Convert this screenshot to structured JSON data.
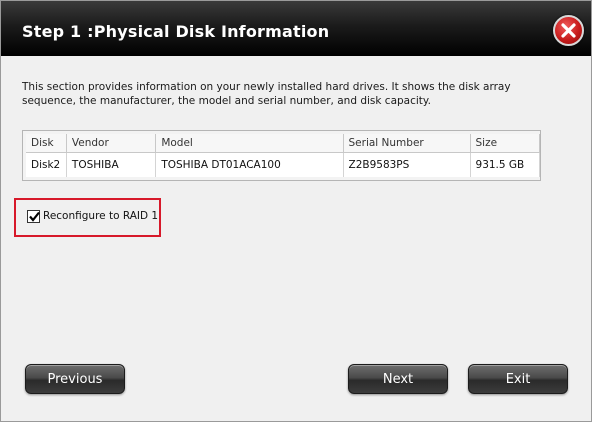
{
  "dialog": {
    "title": "Step 1 :Physical Disk Information",
    "close_icon": "close-icon",
    "description": "This section provides information on your newly installed hard drives. It shows the disk array sequence, the manufacturer, the model and serial number, and disk capacity."
  },
  "table": {
    "headers": [
      "Disk",
      "Vendor",
      "Model",
      "Serial Number",
      "Size"
    ],
    "rows": [
      [
        "Disk2",
        "TOSHIBA",
        "TOSHIBA DT01ACA100",
        "Z2B9583PS",
        "931.5 GB"
      ]
    ]
  },
  "reconfigure": {
    "checked": true,
    "label": "Reconfigure to RAID 1",
    "highlight_color": "#d7192a"
  },
  "buttons": {
    "previous": "Previous",
    "next": "Next",
    "exit": "Exit"
  }
}
